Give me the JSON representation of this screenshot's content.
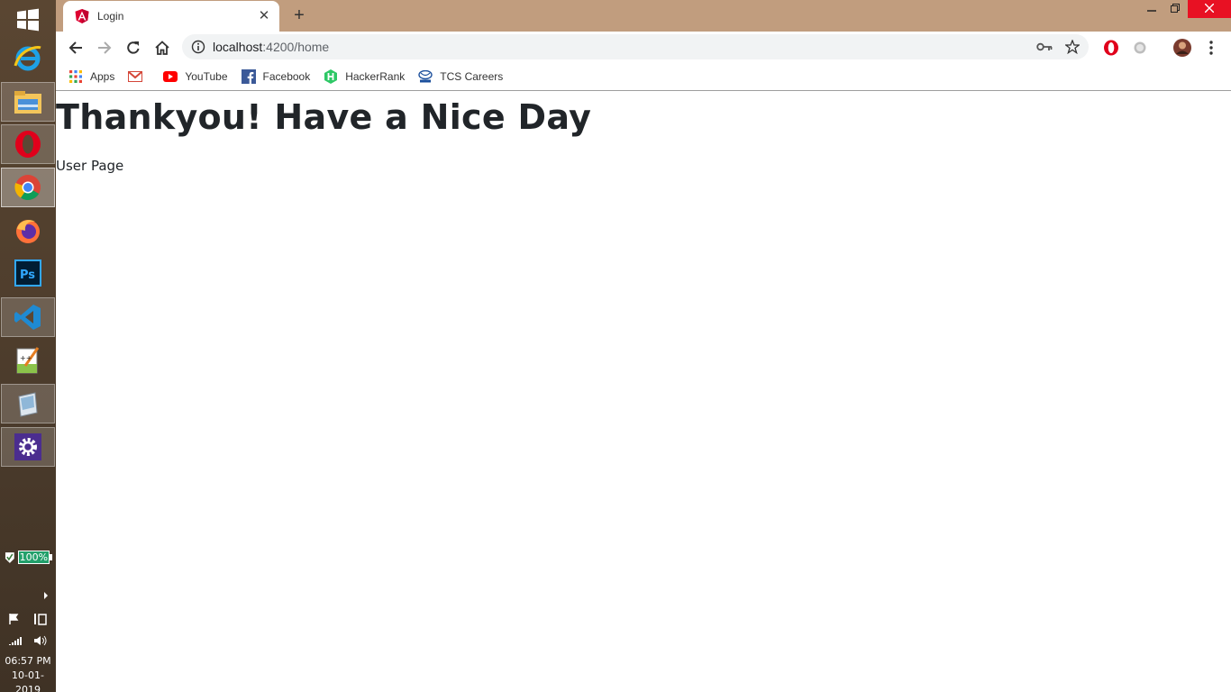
{
  "browser": {
    "tab": {
      "title": "Login",
      "close": "✕"
    },
    "new_tab": "+",
    "url": {
      "host": "localhost",
      "path": ":4200/home"
    },
    "bookmarks": [
      {
        "label": "Apps",
        "icon": "apps-grid-icon"
      },
      {
        "label": "",
        "icon": "gmail-icon"
      },
      {
        "label": "YouTube",
        "icon": "youtube-icon"
      },
      {
        "label": "Facebook",
        "icon": "facebook-icon"
      },
      {
        "label": "HackerRank",
        "icon": "hackerrank-icon"
      },
      {
        "label": "TCS Careers",
        "icon": "tata-icon"
      }
    ]
  },
  "page": {
    "heading": "Thankyou! Have a Nice Day",
    "text": "User Page"
  },
  "taskbar": {
    "battery": "100%",
    "time": "06:57 PM",
    "date": "10-01-2019"
  },
  "colors": {
    "tabstrip": "#c19d7e",
    "close_button": "#e81123",
    "taskbar": "#4b3b2b"
  }
}
